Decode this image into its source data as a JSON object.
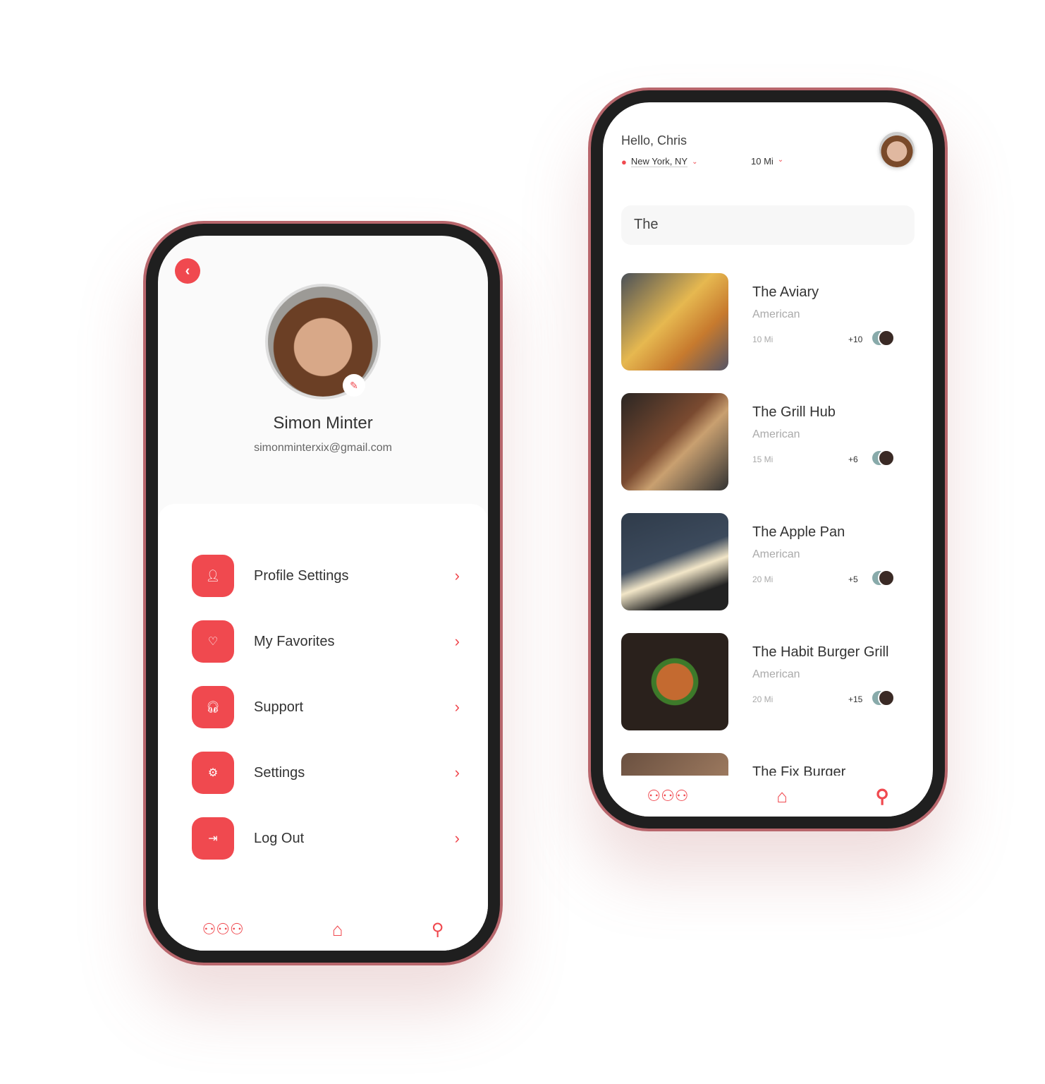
{
  "profile_screen": {
    "back_icon": "chevron-left-icon",
    "name": "Simon Minter",
    "email": "simonminterxix@gmail.com",
    "edit_icon": "edit-icon",
    "menu": [
      {
        "label": "Profile Settings",
        "icon": "user-icon"
      },
      {
        "label": "My Favorites",
        "icon": "heart-icon"
      },
      {
        "label": "Support",
        "icon": "headset-icon"
      },
      {
        "label": "Settings",
        "icon": "gear-icon"
      },
      {
        "label": "Log Out",
        "icon": "logout-icon"
      }
    ],
    "nav": [
      "group-icon",
      "home-icon",
      "search-icon"
    ]
  },
  "search_screen": {
    "greeting": "Hello, Chris",
    "location": "New York, NY",
    "distance": "10 Mi",
    "search_value": "The",
    "restaurants": [
      {
        "name": "The Aviary",
        "category": "American",
        "distance": "10 Mi",
        "extra": "+10"
      },
      {
        "name": "The Grill Hub",
        "category": "American",
        "distance": "15 Mi",
        "extra": "+6"
      },
      {
        "name": "The Apple Pan",
        "category": "American",
        "distance": "20 Mi",
        "extra": "+5"
      },
      {
        "name": "The Habit Burger Grill",
        "category": "American",
        "distance": "20 Mi",
        "extra": "+15"
      },
      {
        "name": "The Fix Burger"
      }
    ],
    "nav": [
      "group-icon",
      "home-icon",
      "search-icon"
    ],
    "active_nav": "search-icon"
  },
  "colors": {
    "accent": "#f0494f",
    "frame": "#b8666c"
  }
}
